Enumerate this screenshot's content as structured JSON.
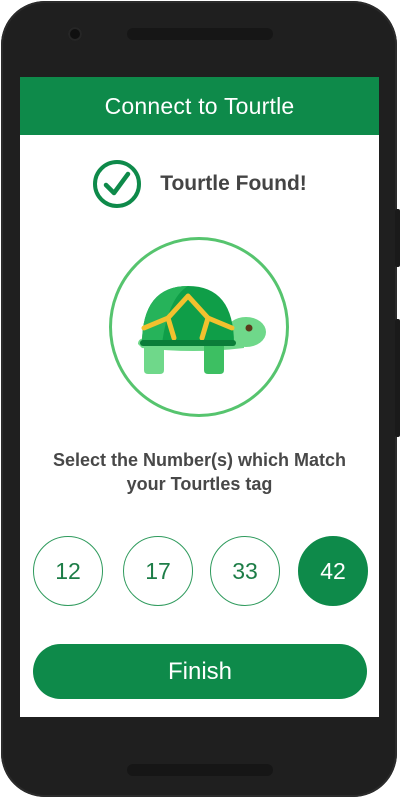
{
  "app_bar": {
    "title": "Connect to Tourtle"
  },
  "status": {
    "icon": "check-circle-icon",
    "text": "Tourtle Found!",
    "color": "#0e8a4a"
  },
  "illustration": {
    "icon": "turtle-icon",
    "ring_color": "#56c46e"
  },
  "instruction": {
    "line1": "Select the Number(s) which Match",
    "line2": "your Tourtles tag"
  },
  "numbers": [
    {
      "label": "12",
      "selected": false
    },
    {
      "label": "17",
      "selected": false
    },
    {
      "label": "33",
      "selected": false
    },
    {
      "label": "42",
      "selected": true
    }
  ],
  "finish_button": {
    "label": "Finish"
  },
  "colors": {
    "primary": "#0e8a4a",
    "text": "#484848"
  }
}
